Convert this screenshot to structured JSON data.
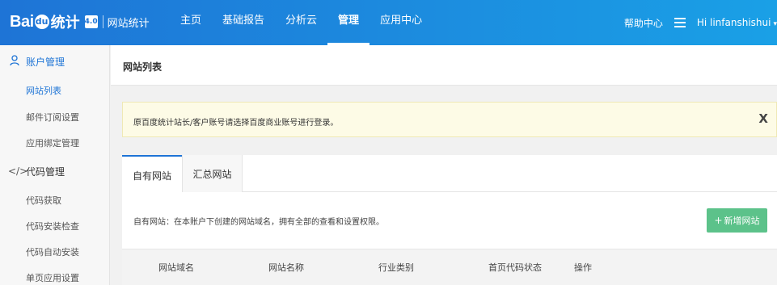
{
  "brand": {
    "logo_bai": "Bai",
    "logo_du": "du",
    "logo_tongji": "统计",
    "version": "4.0",
    "subtitle": "网站统计"
  },
  "nav": {
    "items": [
      {
        "label": "主页",
        "active": false
      },
      {
        "label": "基础报告",
        "active": false
      },
      {
        "label": "分析云",
        "active": false
      },
      {
        "label": "管理",
        "active": true
      },
      {
        "label": "应用中心",
        "active": false
      }
    ]
  },
  "topright": {
    "help": "帮助中心",
    "menu_icon": "list-icon",
    "user": "Hi  linfanshishui"
  },
  "sidebar": {
    "groups": [
      {
        "label": "账户管理",
        "icon": "user-icon",
        "items": [
          "网站列表",
          "邮件订阅设置",
          "应用绑定管理"
        ]
      },
      {
        "label": "代码管理",
        "icon": "code-icon",
        "items": [
          "代码获取",
          "代码安装检查",
          "代码自动安装",
          "单页应用设置"
        ]
      }
    ],
    "active_item": "网站列表"
  },
  "page": {
    "title": "网站列表"
  },
  "alert": {
    "text": "原百度统计站长/客户账号请选择百度商业账号进行登录。",
    "close": "X"
  },
  "tabs": [
    {
      "label": "自有网站",
      "active": true
    },
    {
      "label": "汇总网站",
      "active": false
    }
  ],
  "panel": {
    "description": "自有网站：在本账户下创建的网站域名，拥有全部的查看和设置权限。",
    "add_button": "新增网站"
  },
  "table": {
    "columns": [
      "网站域名",
      "网站名称",
      "行业类别",
      "首页代码状态",
      "操作"
    ]
  },
  "colors": {
    "topbar_start": "#1e74d6",
    "topbar_end": "#1aa0e6",
    "accent": "#1e74d6",
    "add_button": "#5cc28a",
    "alert_bg": "#fdfbe6"
  }
}
